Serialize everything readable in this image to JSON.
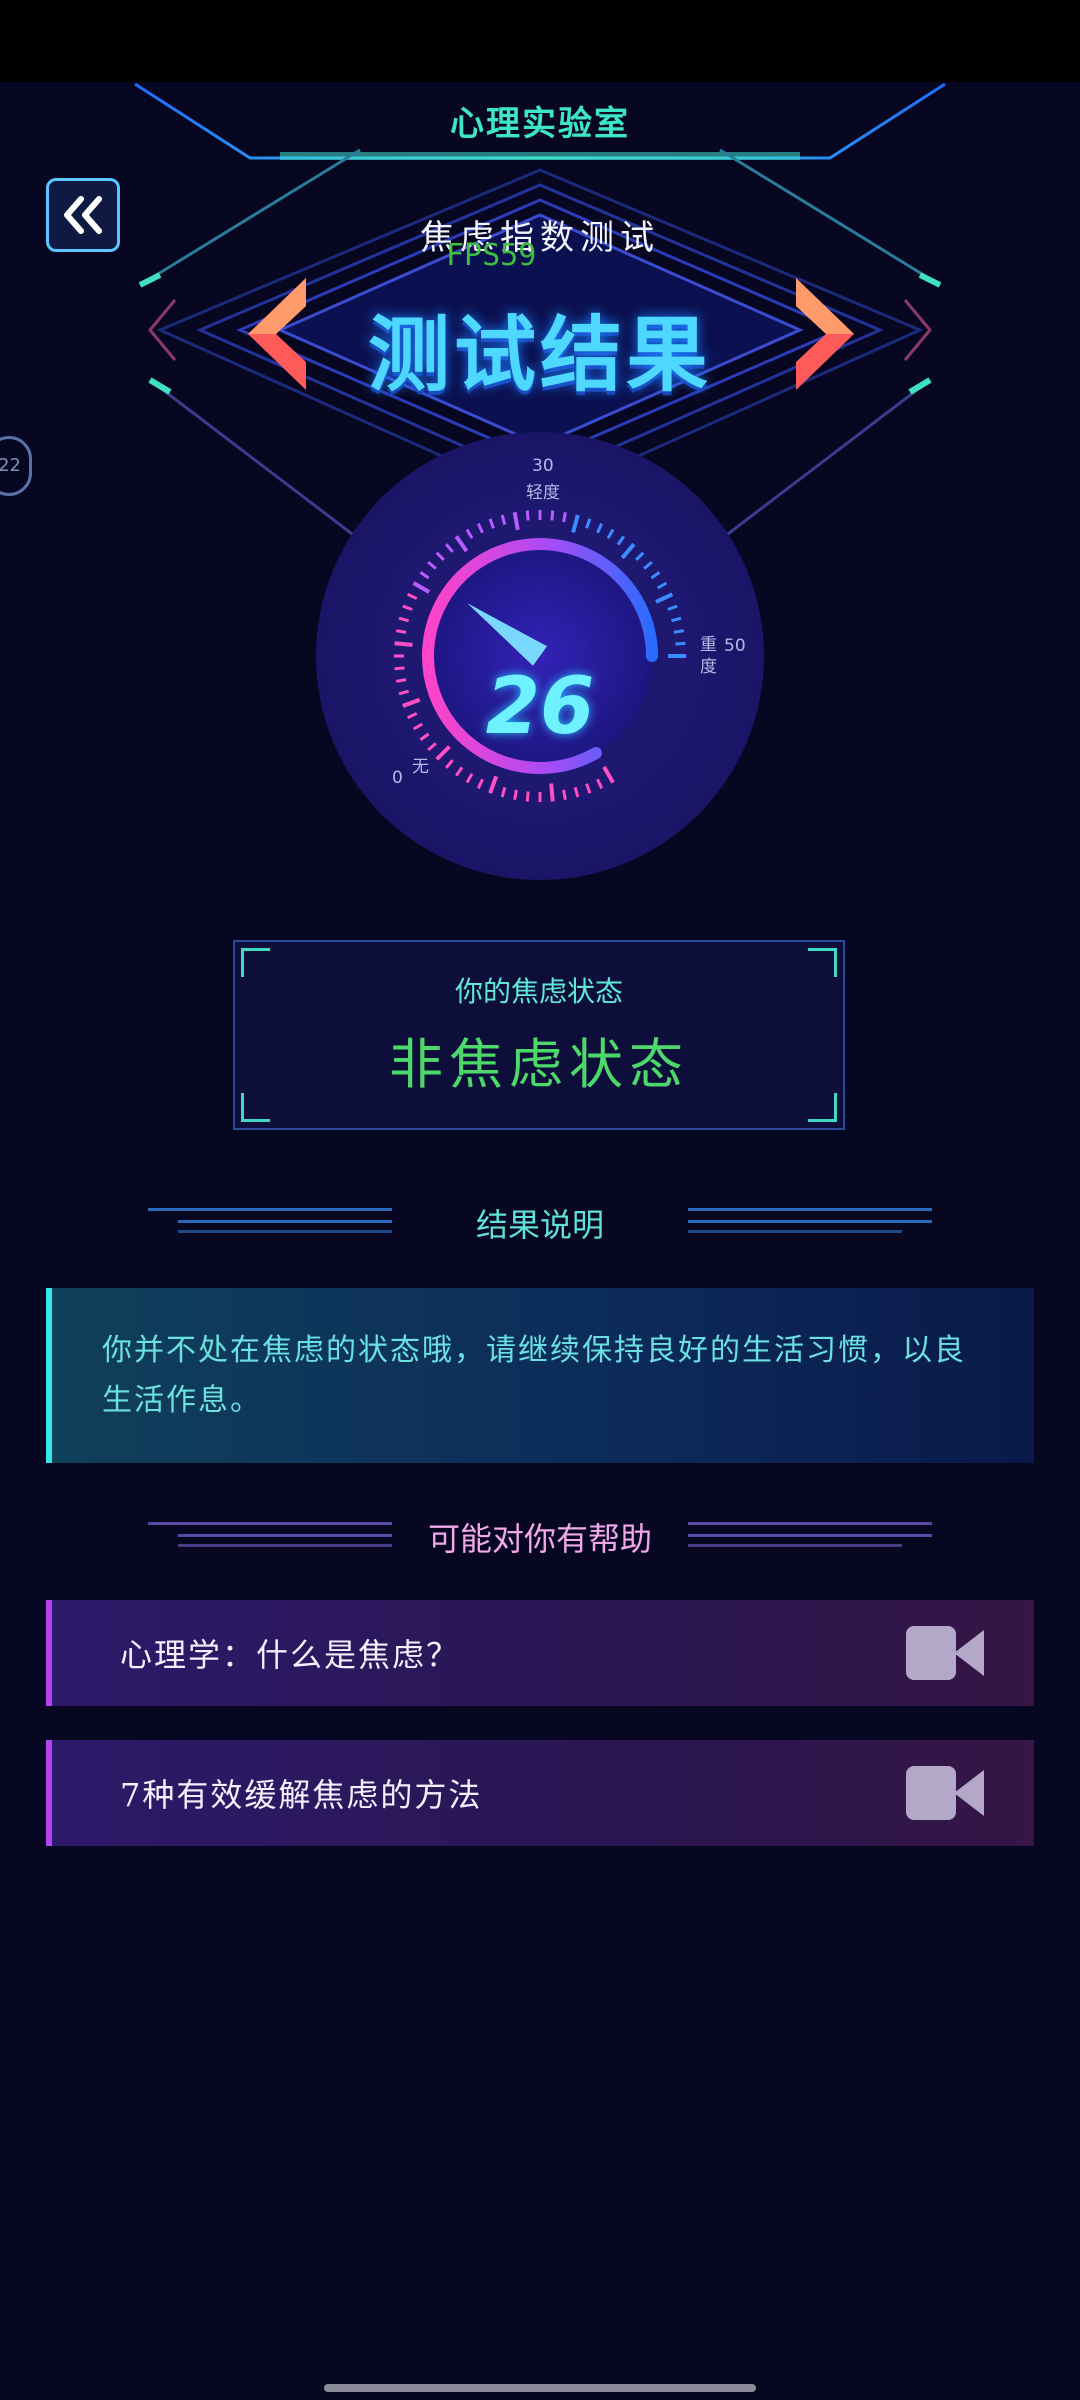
{
  "header": {
    "lab_title": "心理实验室",
    "subtitle": "焦虑指数测试",
    "fps": "FPS59",
    "result_title": "测试结果"
  },
  "icons": {
    "back": "double-chevron-left-icon",
    "prev": "chevron-left-icon",
    "next": "chevron-right-icon",
    "video": "video-camera-icon"
  },
  "side_badge": "22",
  "gauge": {
    "score": "26",
    "value": 26,
    "min": 0,
    "max": 50,
    "label_min": "0",
    "label_min_text": "无",
    "label_top": "30",
    "label_top_text": "轻度",
    "label_max": "50",
    "label_max_text": "重度"
  },
  "status": {
    "label": "你的焦虑状态",
    "value": "非焦虑状态"
  },
  "result": {
    "section_title": "结果说明",
    "description": "你并不处在焦虑的状态哦，请继续保持良好的生活习惯，以良生活作息。"
  },
  "help": {
    "section_title": "可能对你有帮助",
    "items": [
      {
        "label": "心理学：什么是焦虑？"
      },
      {
        "label": "7种有效缓解焦虑的方法"
      }
    ]
  },
  "colors": {
    "background": "#070722",
    "accent_cyan": "#4fd8ff",
    "status_green": "#4cd96a",
    "accent_purple": "#b344f0",
    "arrow_red": "#ff5a5a"
  }
}
